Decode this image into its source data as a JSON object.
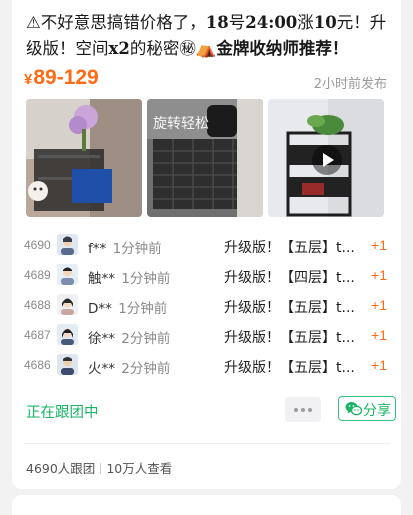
{
  "post": {
    "title_prefix": "⚠不好意思搞错价格了，",
    "title_bold1": "18",
    "title_mid1": "号",
    "title_bold2": "24:00",
    "title_mid2": "涨",
    "title_bold3": "10",
    "title_mid3": "元！升级版！空间",
    "title_bold4": "x2",
    "title_mid4": "的秘密",
    "title_emoji1": "㊙",
    "title_emoji2": "⛺",
    "title_suffix": "金牌收纳师推荐！【T...",
    "price_symbol": "¥",
    "price": "89-129",
    "time_ago": "2小时前发布",
    "image_overlay_text": "旋转轻松"
  },
  "followers": [
    {
      "num": "4690",
      "name": "f**",
      "ago": "1分钟前",
      "desc": "升级版！【五层】t...",
      "plus": "+1"
    },
    {
      "num": "4689",
      "name": "触**",
      "ago": "1分钟前",
      "desc": "升级版！【四层】t...",
      "plus": "+1"
    },
    {
      "num": "4688",
      "name": "D**",
      "ago": "1分钟前",
      "desc": "升级版！【五层】t...",
      "plus": "+1"
    },
    {
      "num": "4687",
      "name": "徐**",
      "ago": "2分钟前",
      "desc": "升级版！【五层】t...",
      "plus": "+1"
    },
    {
      "num": "4686",
      "name": "火**",
      "ago": "2分钟前",
      "desc": "升级版！【五层】t...",
      "plus": "+1"
    }
  ],
  "actions": {
    "following_label": "正在跟团中",
    "share_label": "分享"
  },
  "footer": {
    "joined": "4690人跟团",
    "views": "10万人查看"
  },
  "icons": {
    "more": "more-dots-icon",
    "share": "wechat-icon",
    "play": "play-icon"
  },
  "colors": {
    "accent_orange": "#ff6a14",
    "accent_green": "#18b566"
  }
}
